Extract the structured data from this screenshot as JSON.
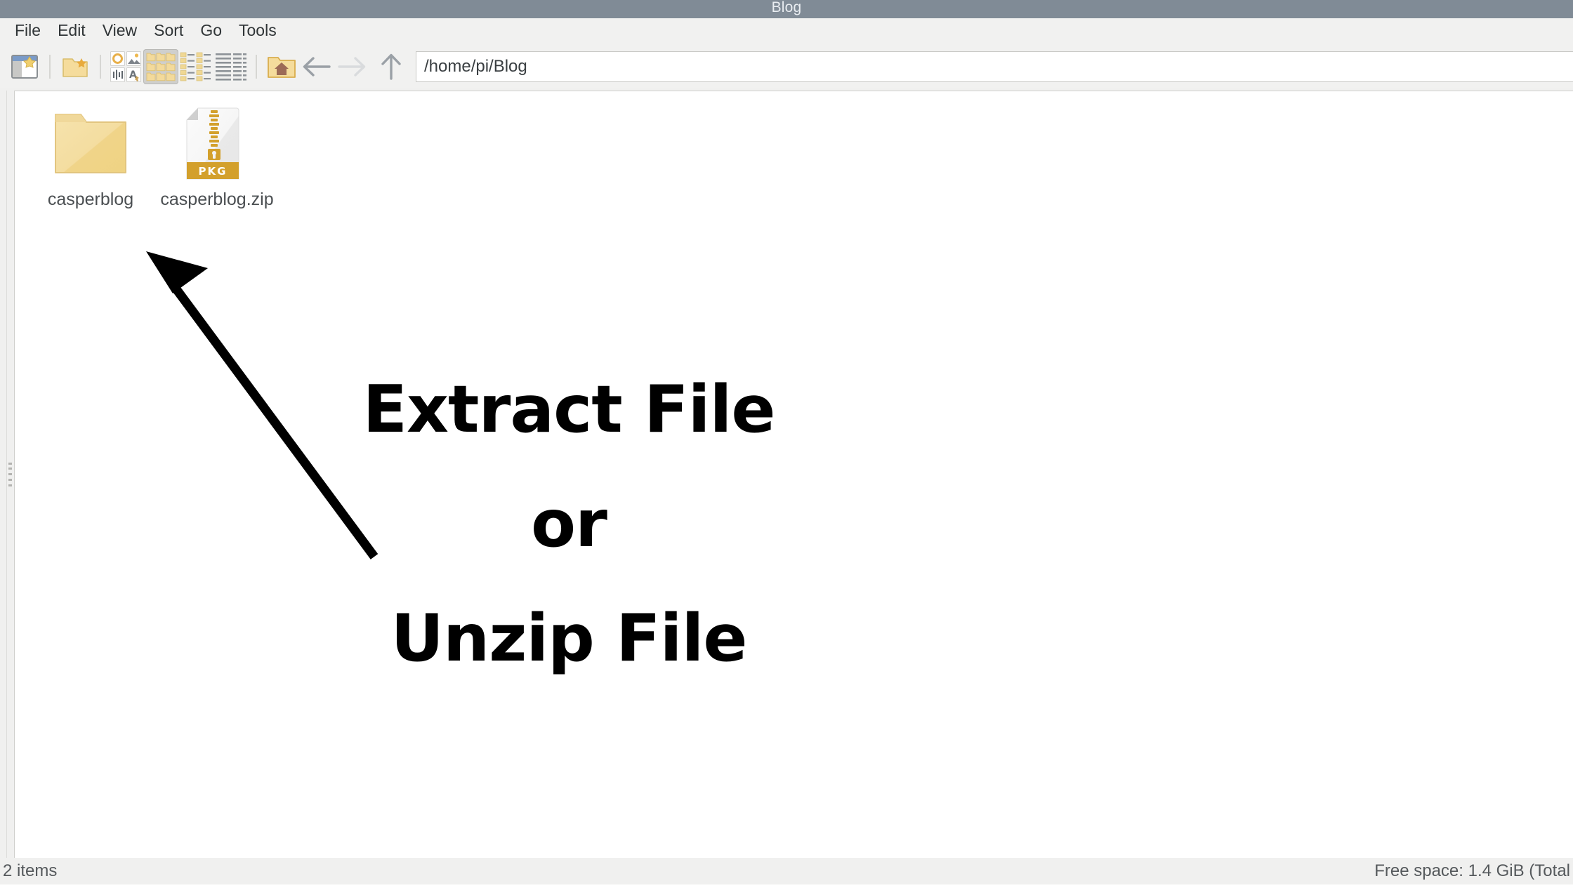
{
  "window": {
    "title": "Blog"
  },
  "menubar": {
    "items": [
      {
        "label": "File"
      },
      {
        "label": "Edit"
      },
      {
        "label": "View"
      },
      {
        "label": "Sort"
      },
      {
        "label": "Go"
      },
      {
        "label": "Tools"
      }
    ]
  },
  "toolbar": {
    "new_tab_icon": "new-window-icon",
    "new_folder_icon": "new-folder-icon",
    "thumbnail_view_icon": "thumbnail-view-icon",
    "icon_view_icon": "icon-view-icon",
    "compact_view_icon": "compact-list-view-icon",
    "detail_view_icon": "detailed-list-view-icon",
    "home_icon": "home-folder-icon",
    "back_icon": "back-arrow-icon",
    "forward_icon": "forward-arrow-icon",
    "up_icon": "up-arrow-icon",
    "active_view": "icon-view-icon"
  },
  "pathbar": {
    "value": "/home/pi/Blog",
    "placeholder": "/home/pi"
  },
  "files": {
    "items": [
      {
        "name": "casperblog",
        "type": "folder",
        "icon": "folder-icon"
      },
      {
        "name": "casperblog.zip",
        "type": "archive",
        "icon": "zip-archive-icon",
        "badge": "PKG"
      }
    ]
  },
  "statusbar": {
    "left": "2 items",
    "right": "Free space: 1.4 GiB (Total"
  },
  "annotation": {
    "line1": "Extract File",
    "line2": "or",
    "line3": "Unzip File",
    "arrow": "annotation-arrow",
    "color": "#000000"
  },
  "colors": {
    "titlebar": "#808b96",
    "chrome": "#f1f1f0",
    "folder": "#f3dc9a",
    "pkg_badge": "#d6a32e",
    "text": "#4b4f52"
  }
}
